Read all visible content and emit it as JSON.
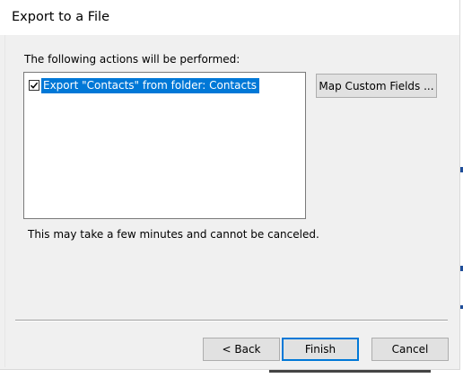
{
  "window": {
    "title": "Export to a File"
  },
  "main": {
    "section_label": "The following actions will be performed:",
    "actions": [
      {
        "label": "Export \"Contacts\" from folder: Contacts",
        "checked": true,
        "selected": true
      }
    ],
    "notice": "This may take a few minutes and cannot be canceled."
  },
  "buttons": {
    "map_custom_fields": "Map Custom Fields ...",
    "back": "< Back",
    "finish": "Finish",
    "cancel": "Cancel"
  },
  "colors": {
    "selection": "#0078d7",
    "dialog_bg": "#f0f0f0",
    "button_bg": "#e1e1e1"
  },
  "icons": {
    "checkbox": "checkmark-icon"
  }
}
